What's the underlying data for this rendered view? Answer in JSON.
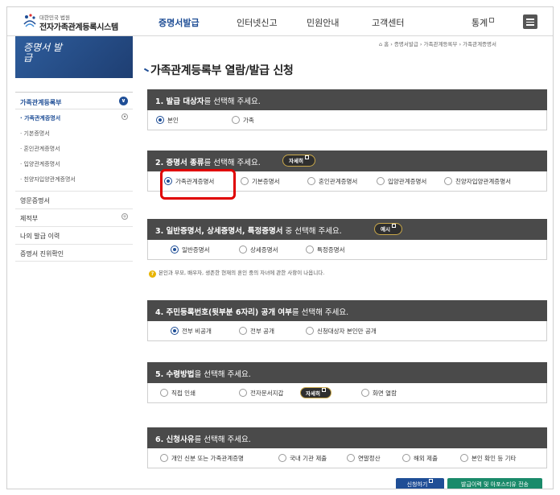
{
  "header": {
    "logo_small": "대한민국 법원",
    "logo_main": "전자가족관계등록시스템",
    "nav": [
      {
        "label": "증명서발급",
        "active": true,
        "ext": false
      },
      {
        "label": "인터넷신고",
        "active": false,
        "ext": false
      },
      {
        "label": "민원안내",
        "active": false,
        "ext": false
      },
      {
        "label": "고객센터",
        "active": false,
        "ext": false
      },
      {
        "label": "통계",
        "active": false,
        "ext": true
      }
    ]
  },
  "sidebar": {
    "banner_title": "증명서 발급",
    "group_label": "가족관계등록부",
    "sub_items": [
      {
        "label": "· 가족관계증명서",
        "active": true
      },
      {
        "label": "· 기본증명서",
        "active": false
      },
      {
        "label": "· 혼인관계증명서",
        "active": false
      },
      {
        "label": "· 입양관계증명서",
        "active": false
      },
      {
        "label": "· 친양자입양관계증명서",
        "active": false
      }
    ],
    "items": [
      {
        "label": "영문증명서",
        "expand": false
      },
      {
        "label": "제적부",
        "expand": true
      },
      {
        "label": "나의 발급 이력",
        "expand": false
      },
      {
        "label": "증명서 진위확인",
        "expand": false
      }
    ]
  },
  "breadcrumb": "⌂ 홈  ›  증명서발급  ›  가족관계등록부  ›  가족관계증명서",
  "page_title": "가족관계등록부 열람/발급 신청",
  "sections": [
    {
      "title_pre": "1. 발급 대상자",
      "title_post": "를 선택해 주세요.",
      "button": "",
      "options": [
        {
          "label": "본인",
          "checked": true
        },
        {
          "label": "가족",
          "checked": false
        }
      ]
    },
    {
      "title_pre": "2. 증명서 종류",
      "title_post": "를 선택해 주세요.",
      "button": "자세히",
      "options": [
        {
          "label": "가족관계증명서",
          "checked": true
        },
        {
          "label": "기본증명서",
          "checked": false
        },
        {
          "label": "혼인관계증명서",
          "checked": false
        },
        {
          "label": "입양관계증명서",
          "checked": false
        },
        {
          "label": "친양자입양관계증명서",
          "checked": false
        }
      ]
    },
    {
      "title_pre": "3. 일반증명서, 상세증명서, 특정증명서",
      "title_post": " 중 선택해 주세요.",
      "button": "예시",
      "options": [
        {
          "label": "일반증명서",
          "checked": true
        },
        {
          "label": "상세증명서",
          "checked": false
        },
        {
          "label": "특정증명서",
          "checked": false
        }
      ]
    },
    {
      "title_pre": "4. 주민등록번호(뒷부분 6자리) 공개 여부",
      "title_post": "를 선택해 주세요.",
      "button": "",
      "options": [
        {
          "label": "전부 비공개",
          "checked": true
        },
        {
          "label": "전부 공개",
          "checked": false
        },
        {
          "label": "신청대상자 본인만 공개",
          "checked": false
        }
      ]
    },
    {
      "title_pre": "5. 수령방법",
      "title_post": "을 선택해 주세요.",
      "button": "",
      "inline_button": "자세히",
      "options": [
        {
          "label": "직접 인쇄",
          "checked": false
        },
        {
          "label": "전자문서지갑",
          "checked": false
        },
        {
          "label": "화면 열람",
          "checked": false
        }
      ]
    },
    {
      "title_pre": "6. 신청사유",
      "title_post": "를 선택해 주세요.",
      "button": "",
      "options": [
        {
          "label": "개인 신분 또는 가족관계증명",
          "checked": false
        },
        {
          "label": "국내 기관 제출",
          "checked": false
        },
        {
          "label": "연말정산",
          "checked": false
        },
        {
          "label": "해외 제출",
          "checked": false
        },
        {
          "label": "본인 확인 등 기타",
          "checked": false
        }
      ]
    }
  ],
  "note_icon": "?",
  "note_text": "본인과 부모, 배우자, 생존한 현재의 혼인 중의 자녀에 관한 사항이 나옵니다.",
  "buttons": {
    "apply": "신청하기",
    "send": "발급이력 및 아포스티유 전송"
  },
  "colors": {
    "brand": "#1f4e96",
    "section_header": "#4a4a4a",
    "send_button": "#1a8a6a",
    "highlight": "#e00000"
  }
}
